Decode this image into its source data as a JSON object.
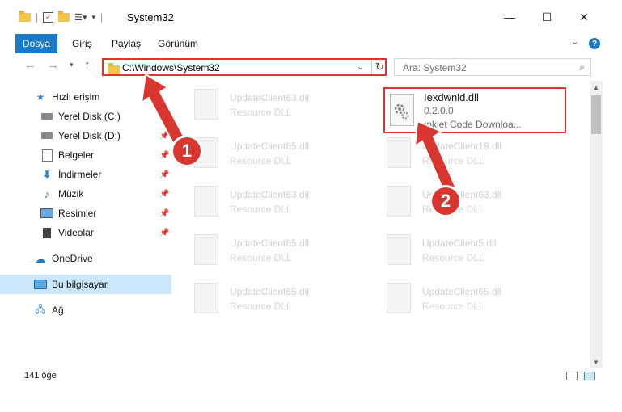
{
  "window": {
    "title": "System32",
    "minimize": "—",
    "maximize": "☐",
    "close": "✕"
  },
  "ribbon": {
    "tabs": [
      "Dosya",
      "Giriş",
      "Paylaş",
      "Görünüm"
    ],
    "help": "?"
  },
  "address": {
    "path": "C:\\Windows\\System32",
    "search_placeholder": "Ara: System32"
  },
  "sidebar": {
    "items": [
      {
        "label": "Hızlı erişim",
        "icon": "star-icon",
        "pinned": false
      },
      {
        "label": "Yerel Disk (C:)",
        "icon": "drive-icon",
        "pinned": true
      },
      {
        "label": "Yerel Disk (D:)",
        "icon": "drive-icon",
        "pinned": true
      },
      {
        "label": "Belgeler",
        "icon": "documents-icon",
        "pinned": true
      },
      {
        "label": "İndirmeler",
        "icon": "download-icon",
        "pinned": true
      },
      {
        "label": "Müzik",
        "icon": "music-icon",
        "pinned": true
      },
      {
        "label": "Resimler",
        "icon": "pictures-icon",
        "pinned": true
      },
      {
        "label": "Videolar",
        "icon": "video-icon",
        "pinned": true
      },
      {
        "label": "OneDrive",
        "icon": "cloud-icon",
        "pinned": false
      },
      {
        "label": "Bu bilgisayar",
        "icon": "computer-icon",
        "pinned": false,
        "selected": true
      },
      {
        "label": "Ağ",
        "icon": "network-icon",
        "pinned": false
      }
    ]
  },
  "files": [
    {
      "name": "UpdateClient63.dll",
      "type": "Resource DLL"
    },
    {
      "name": "UpdateClient65.dll",
      "type": "Resource DLL"
    },
    {
      "name": "UpdateClient19.dll",
      "type": "Resource DLL"
    },
    {
      "name": "UpdateClient63.dll",
      "type": "Resource DLL"
    },
    {
      "name": "UpdateClient63.dll",
      "type": "Resource DLL"
    },
    {
      "name": "UpdateClient65.dll",
      "type": "Resource DLL"
    },
    {
      "name": "UpdateClient5.dll",
      "type": "Resource DLL"
    },
    {
      "name": "UpdateClient65.dll",
      "type": "Resource DLL"
    },
    {
      "name": "UpdateClient65.dll",
      "type": "Resource DLL"
    }
  ],
  "target_file": {
    "name": "Iexdwnld.dll",
    "version": "0.2.0.0",
    "description": "Inkjet Code Downloa..."
  },
  "status": {
    "item_count": "141 öğe"
  },
  "callouts": {
    "step1": "1",
    "step2": "2",
    "accent": "#d9362f"
  }
}
